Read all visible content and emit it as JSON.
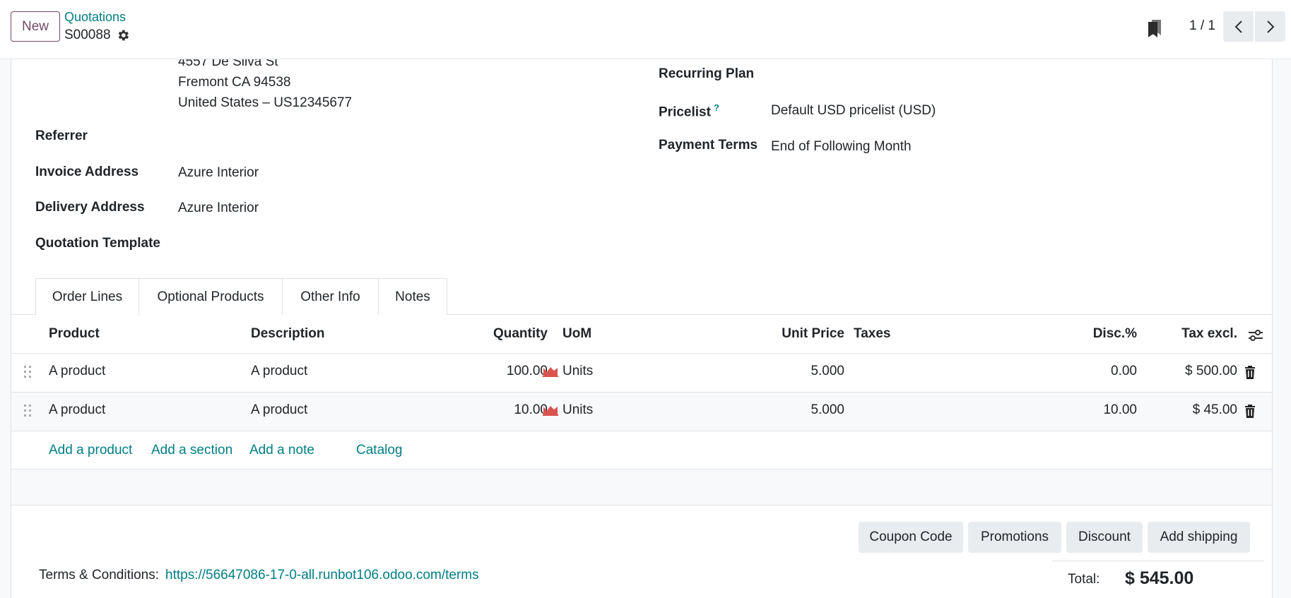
{
  "topbar": {
    "new_label": "New",
    "breadcrumb_parent": "Quotations",
    "breadcrumb_current": "S00088",
    "pager_value": "1 / 1"
  },
  "customer_address": {
    "street": "4557 De Silva St",
    "city_line": "Fremont CA 94538",
    "country_line": "United States – US12345677"
  },
  "left_fields": [
    {
      "label": "Referrer",
      "value": ""
    },
    {
      "label": "Invoice Address",
      "value": "Azure Interior"
    },
    {
      "label": "Delivery Address",
      "value": "Azure Interior"
    },
    {
      "label": "Quotation Template",
      "value": ""
    }
  ],
  "right_fields": {
    "recurring_plan": {
      "label": "Recurring Plan",
      "value": ""
    },
    "pricelist": {
      "label": "Pricelist",
      "help": "?",
      "value": "Default USD pricelist (USD)"
    },
    "payment_terms": {
      "label": "Payment Terms",
      "value": "End of Following Month"
    }
  },
  "tabs": [
    {
      "label": "Order Lines",
      "active": true
    },
    {
      "label": "Optional Products",
      "active": false
    },
    {
      "label": "Other Info",
      "active": false
    },
    {
      "label": "Notes",
      "active": false
    }
  ],
  "table": {
    "headers": {
      "product": "Product",
      "description": "Description",
      "quantity": "Quantity",
      "uom": "UoM",
      "unit_price": "Unit Price",
      "taxes": "Taxes",
      "discount": "Disc.%",
      "tax_excl": "Tax excl."
    },
    "rows": [
      {
        "product": "A product",
        "description": "A product",
        "quantity": "100.00",
        "uom": "Units",
        "unit_price": "5.000",
        "taxes": "",
        "discount": "0.00",
        "subtotal": "$ 500.00"
      },
      {
        "product": "A product",
        "description": "A product",
        "quantity": "10.00",
        "uom": "Units",
        "unit_price": "5.000",
        "taxes": "",
        "discount": "10.00",
        "subtotal": "$ 45.00"
      }
    ],
    "add_links": {
      "product": "Add a product",
      "section": "Add a section",
      "note": "Add a note",
      "catalog": "Catalog"
    }
  },
  "actions": {
    "coupon": "Coupon Code",
    "promotions": "Promotions",
    "discount": "Discount",
    "shipping": "Add shipping"
  },
  "terms": {
    "label": "Terms & Conditions:",
    "url": "https://56647086-17-0-all.runbot106.odoo.com/terms"
  },
  "totals": {
    "label": "Total:",
    "value": "$ 545.00"
  },
  "colors": {
    "brand": "#714b67",
    "link": "#017e84",
    "forecast_icon": "#d9534f"
  }
}
